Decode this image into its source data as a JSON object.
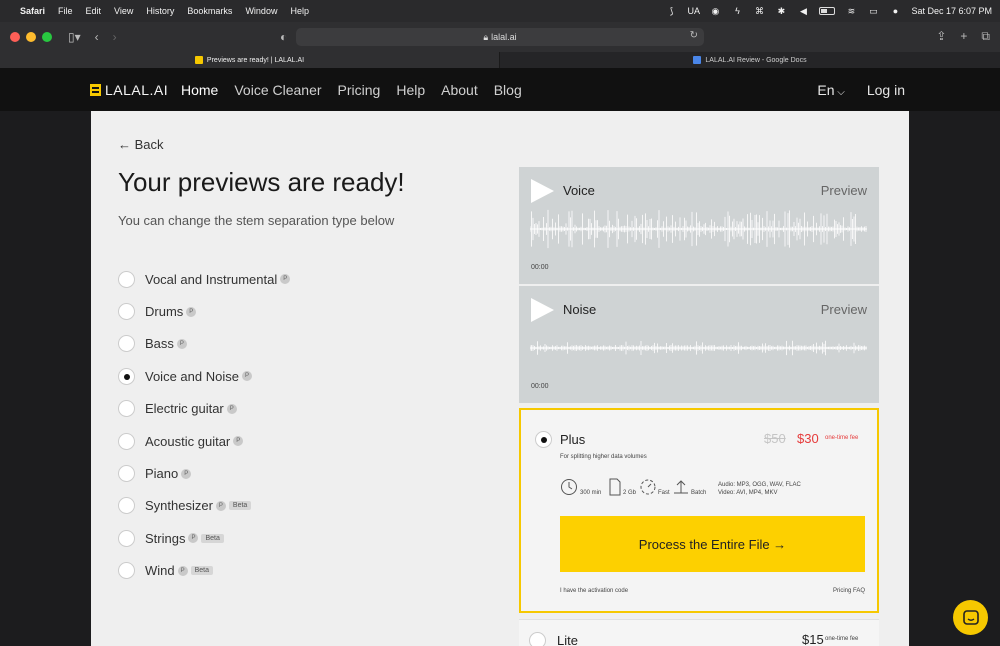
{
  "menubar": {
    "app": "Safari",
    "items": [
      "File",
      "Edit",
      "View",
      "History",
      "Bookmarks",
      "Window",
      "Help"
    ],
    "input_source": "UA",
    "datetime": "Sat Dec 17  6:07 PM"
  },
  "browser": {
    "url": "lalal.ai",
    "tabs": [
      {
        "title": "Previews are ready! | LALAL.AI",
        "active": true
      },
      {
        "title": "LALAL.AI Review - Google Docs",
        "active": false
      }
    ]
  },
  "site": {
    "logo": "LALAL.AI",
    "nav": [
      "Home",
      "Voice Cleaner",
      "Pricing",
      "Help",
      "About",
      "Blog"
    ],
    "lang": "En",
    "login": "Log in"
  },
  "page": {
    "back": "← Back",
    "title": "Your previews are ready!",
    "subtitle": "You can change the stem separation type below",
    "options": [
      {
        "label": "Vocal and Instrumental",
        "badge": "P",
        "beta": "",
        "selected": false
      },
      {
        "label": "Drums",
        "badge": "P",
        "beta": "",
        "selected": false
      },
      {
        "label": "Bass",
        "badge": "P",
        "beta": "",
        "selected": false
      },
      {
        "label": "Voice and Noise",
        "badge": "P",
        "beta": "",
        "selected": true
      },
      {
        "label": "Electric guitar",
        "badge": "P",
        "beta": "",
        "selected": false
      },
      {
        "label": "Acoustic guitar",
        "badge": "P",
        "beta": "",
        "selected": false
      },
      {
        "label": "Piano",
        "badge": "P",
        "beta": "",
        "selected": false
      },
      {
        "label": "Synthesizer",
        "badge": "P",
        "beta": "Beta",
        "selected": false
      },
      {
        "label": "Strings",
        "badge": "P",
        "beta": "Beta",
        "selected": false
      },
      {
        "label": "Wind",
        "badge": "P",
        "beta": "Beta",
        "selected": false
      }
    ]
  },
  "tracks": [
    {
      "name": "Voice",
      "preview": "Preview",
      "time": "00:00"
    },
    {
      "name": "Noise",
      "preview": "Preview",
      "time": "00:00"
    }
  ],
  "plan": {
    "name": "Plus",
    "old_price": "$50",
    "price": "$30",
    "fee": "one-time fee",
    "description": "For splitting higher data volumes",
    "features": [
      {
        "icon": "clock-icon",
        "label": "300 min"
      },
      {
        "icon": "file-icon",
        "label": "2 Gb"
      },
      {
        "icon": "speed-icon",
        "label": "Fast"
      },
      {
        "icon": "upload-icon",
        "label": "Batch"
      }
    ],
    "formats_audio": "Audio: MP3, OGG, WAV, FLAC",
    "formats_video": "Video: AVI, MP4, MKV",
    "cta": "Process the Entire File →",
    "activation": "I have the activation code",
    "faq": "Pricing FAQ"
  },
  "plan2": {
    "name": "Lite",
    "price": "$15",
    "fee": "one-time fee"
  },
  "colors": {
    "accent": "#f6c800",
    "cta": "#fdd000",
    "sale": "#e63b3b",
    "track_bg": "#cfd3d4"
  }
}
